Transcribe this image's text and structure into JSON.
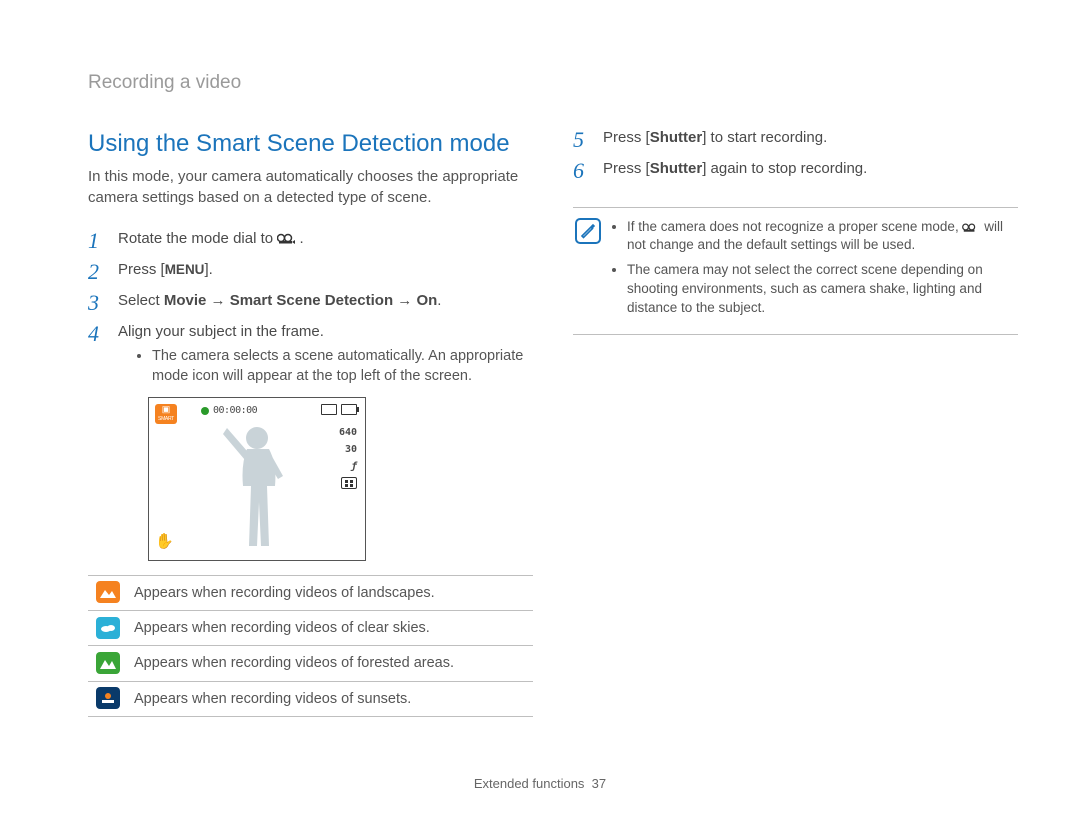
{
  "header": {
    "breadcrumb": "Recording a video"
  },
  "heading": "Using the Smart Scene Detection mode",
  "intro": "In this mode, your camera automatically chooses the appropriate camera settings based on a detected type of scene.",
  "steps": {
    "s1": {
      "num": "1",
      "prefix": "Rotate the mode dial to ",
      "suffix": "."
    },
    "s2": {
      "num": "2",
      "prefix": "Press [",
      "menu": "MENU",
      "suffix": "]."
    },
    "s3": {
      "num": "3",
      "prefix": "Select ",
      "b1": "Movie",
      "arrow": " → ",
      "b2": "Smart Scene Detection",
      "b3": "On",
      "suffix": "."
    },
    "s4": {
      "num": "4",
      "text": "Align your subject in the frame.",
      "bullet": "The camera selects a scene automatically. An appropriate mode icon will appear at the top left of the screen."
    },
    "s5": {
      "num": "5",
      "prefix": "Press [",
      "bold": "Shutter",
      "suffix": "] to start recording."
    },
    "s6": {
      "num": "6",
      "prefix": "Press [",
      "bold": "Shutter",
      "suffix": "] again to stop recording."
    }
  },
  "screen": {
    "badge_top": "▣",
    "badge_text": "SMART",
    "timer": "00:00:00",
    "res": "640",
    "fps": "30",
    "curve": "ƒ"
  },
  "scene_icons": [
    {
      "color": "bg-orange",
      "desc": "Appears when recording videos of landscapes."
    },
    {
      "color": "bg-cyan",
      "desc": "Appears when recording videos of clear skies."
    },
    {
      "color": "bg-green",
      "desc": "Appears when recording videos of forested areas."
    },
    {
      "color": "bg-navy",
      "desc": "Appears when recording videos of sunsets."
    }
  ],
  "notes": {
    "n1a": "If the camera does not recognize a proper scene mode, ",
    "n1b": " will not change and the default settings will be used.",
    "n2": "The camera may not select the correct scene depending on shooting environments, such as camera shake, lighting and distance to the subject."
  },
  "footer": {
    "section": "Extended functions",
    "page": "37"
  }
}
